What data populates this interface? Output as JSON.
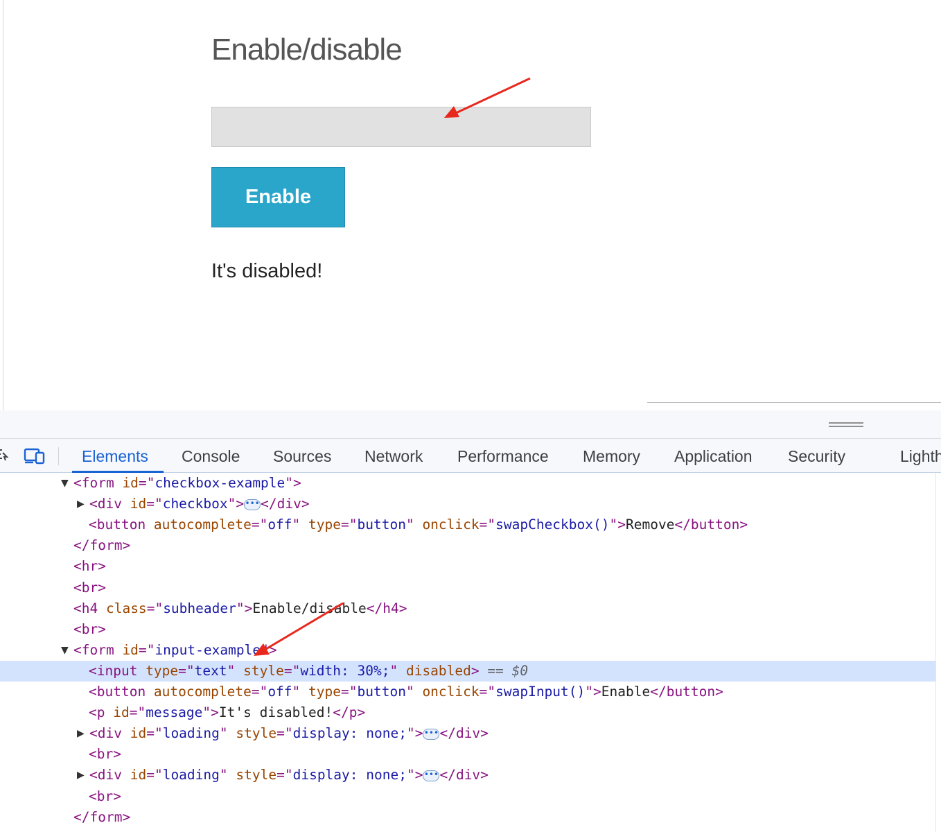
{
  "page": {
    "subheader": "Enable/disable",
    "input_value": "",
    "enable_button_label": "Enable",
    "message": "It's disabled!"
  },
  "devtools": {
    "tabs": [
      "Elements",
      "Console",
      "Sources",
      "Network",
      "Performance",
      "Memory",
      "Application",
      "Security",
      "Lighth"
    ],
    "active_tab": "Elements",
    "dom_lines": [
      "<form id=\"checkbox-example\">",
      "<div id=\"checkbox\">…</div>",
      "<button autocomplete=\"off\" type=\"button\" onclick=\"swapCheckbox()\">Remove</button>",
      "</form>",
      "<hr>",
      "<br>",
      "<h4 class=\"subheader\">Enable/disable</h4>",
      "<br>",
      "<form id=\"input-example\">",
      "<input type=\"text\" style=\"width: 30%;\" disabled> == $0",
      "<button autocomplete=\"off\" type=\"button\" onclick=\"swapInput()\">Enable</button>",
      "<p id=\"message\">It's disabled!</p>",
      "<div id=\"loading\" style=\"display: none;\">…</div>",
      "<br>",
      "<div id=\"loading\" style=\"display: none;\">…</div>",
      "<br>",
      "</form>"
    ],
    "selected_line": 9
  },
  "colors": {
    "button_bg": "#2ba6cb",
    "annotation_arrow": "#e8281c",
    "selected_row_bg": "#d3e3fd",
    "active_tab": "#1a63d2"
  }
}
